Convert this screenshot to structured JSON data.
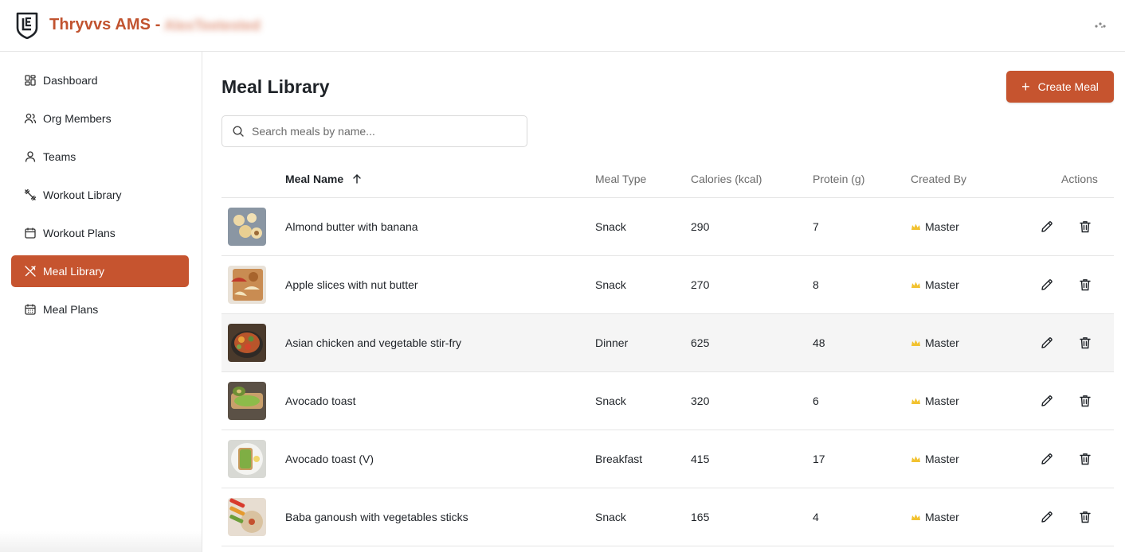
{
  "header": {
    "app_title": "Thryvvs AMS -",
    "org_name": "AlexTeetested"
  },
  "sidebar": {
    "items": [
      {
        "label": "Dashboard",
        "icon": "dashboard-grid-icon",
        "active": false
      },
      {
        "label": "Org Members",
        "icon": "users-icon",
        "active": false
      },
      {
        "label": "Teams",
        "icon": "user-icon",
        "active": false
      },
      {
        "label": "Workout Library",
        "icon": "dumbbell-icon",
        "active": false
      },
      {
        "label": "Workout Plans",
        "icon": "calendar-icon",
        "active": false
      },
      {
        "label": "Meal Library",
        "icon": "utensils-icon",
        "active": true
      },
      {
        "label": "Meal Plans",
        "icon": "calendar-days-icon",
        "active": false
      }
    ]
  },
  "main": {
    "title": "Meal Library",
    "create_button": "Create Meal",
    "search_placeholder": "Search meals by name..."
  },
  "table": {
    "columns": {
      "name": "Meal Name",
      "type": "Meal Type",
      "calories": "Calories (kcal)",
      "protein": "Protein (g)",
      "created_by": "Created By",
      "actions": "Actions"
    },
    "sort": {
      "column": "name",
      "direction": "ascending"
    },
    "rows": [
      {
        "name": "Almond butter with banana",
        "type": "Snack",
        "calories": "290",
        "protein": "7",
        "created_by": "Master"
      },
      {
        "name": "Apple slices with nut butter",
        "type": "Snack",
        "calories": "270",
        "protein": "8",
        "created_by": "Master"
      },
      {
        "name": "Asian chicken and vegetable stir-fry",
        "type": "Dinner",
        "calories": "625",
        "protein": "48",
        "created_by": "Master"
      },
      {
        "name": "Avocado toast",
        "type": "Snack",
        "calories": "320",
        "protein": "6",
        "created_by": "Master"
      },
      {
        "name": "Avocado toast (V)",
        "type": "Breakfast",
        "calories": "415",
        "protein": "17",
        "created_by": "Master"
      },
      {
        "name": "Baba ganoush with vegetables sticks",
        "type": "Snack",
        "calories": "165",
        "protein": "4",
        "created_by": "Master"
      }
    ]
  },
  "colors": {
    "accent": "#c6542f",
    "brand_text": "#c1532f",
    "crown": "#f2c230"
  }
}
